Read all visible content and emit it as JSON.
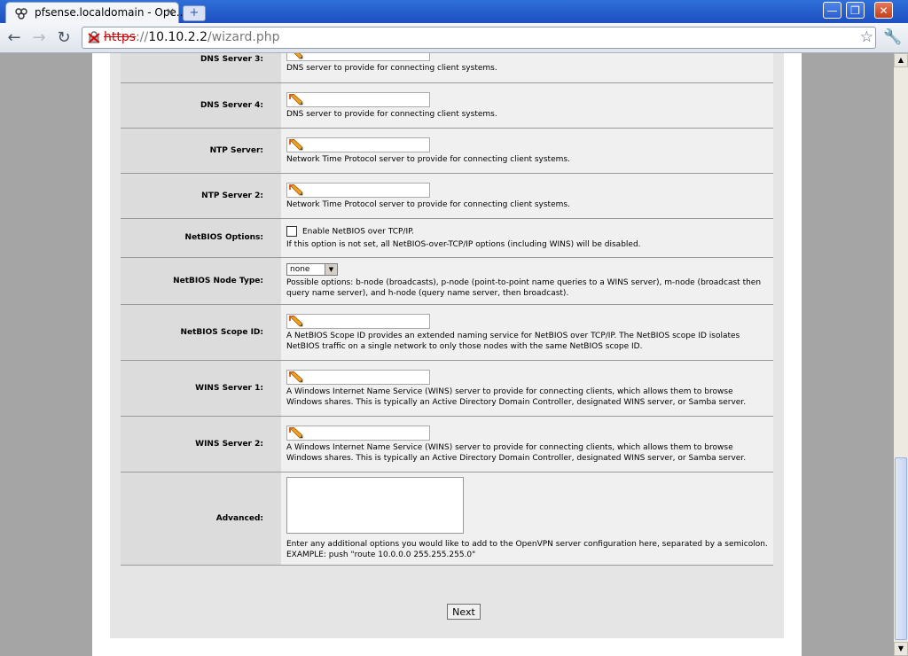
{
  "browser": {
    "tab_title": "pfsense.localdomain - Ope...",
    "tab_close": "×",
    "new_tab": "+",
    "url_protocol": "https",
    "url_sep": "://",
    "url_host": "10.10.2.2",
    "url_path": "/wizard.php",
    "window_buttons": {
      "minimize": "—",
      "maximize": "❐",
      "close": "✕"
    }
  },
  "form": {
    "rows": [
      {
        "label": "DNS Server 3:",
        "type": "text",
        "desc": "DNS server to provide for connecting client systems."
      },
      {
        "label": "DNS Server 4:",
        "type": "text",
        "desc": "DNS server to provide for connecting client systems."
      },
      {
        "label": "NTP Server:",
        "type": "text",
        "desc": "Network Time Protocol server to provide for connecting client systems."
      },
      {
        "label": "NTP Server 2:",
        "type": "text",
        "desc": "Network Time Protocol server to provide for connecting client systems."
      },
      {
        "label": "NetBIOS Options:",
        "type": "checkbox",
        "checkbox_label": "Enable NetBIOS over TCP/IP.",
        "desc": "If this option is not set, all NetBIOS-over-TCP/IP options (including WINS) will be disabled."
      },
      {
        "label": "NetBIOS Node Type:",
        "type": "select",
        "select_value": "none",
        "desc": "Possible options: b-node (broadcasts), p-node (point-to-point name queries to a WINS server), m-node (broadcast then query name server), and h-node (query name server, then broadcast)."
      },
      {
        "label": "NetBIOS Scope ID:",
        "type": "text",
        "desc": "A NetBIOS Scope ID provides an extended naming service for NetBIOS over TCP/IP. The NetBIOS scope ID isolates NetBIOS traffic on a single network to only those nodes with the same NetBIOS scope ID."
      },
      {
        "label": "WINS Server 1:",
        "type": "text",
        "desc": "A Windows Internet Name Service (WINS) server to provide for connecting clients, which allows them to browse Windows shares. This is typically an Active Directory Domain Controller, designated WINS server, or Samba server."
      },
      {
        "label": "WINS Server 2:",
        "type": "text",
        "desc": "A Windows Internet Name Service (WINS) server to provide for connecting clients, which allows them to browse Windows shares. This is typically an Active Directory Domain Controller, designated WINS server, or Samba server."
      },
      {
        "label": "Advanced:",
        "type": "textarea",
        "desc": "Enter any additional options you would like to add to the OpenVPN server configuration here, separated by a semicolon.",
        "desc2": "EXAMPLE: push \"route 10.0.0.0 255.255.255.0\""
      }
    ],
    "next_label": "Next"
  }
}
